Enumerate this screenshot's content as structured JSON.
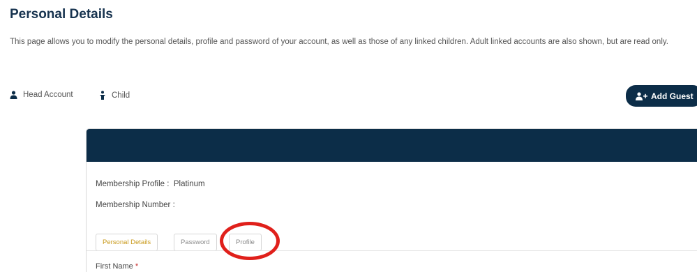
{
  "page": {
    "title": "Personal Details",
    "intro": "This page allows you to modify the personal details, profile and password of your account, as well as those of any linked children. Adult linked accounts are also shown, but are read only."
  },
  "legend": {
    "head_account": {
      "label": "Head Account",
      "icon": "person-icon"
    },
    "child": {
      "label": "Child",
      "icon": "child-icon"
    }
  },
  "actions": {
    "add_guest": {
      "label": "Add Guest",
      "icon": "add-person-icon"
    }
  },
  "card": {
    "membership_profile_label": "Membership Profile :",
    "membership_profile_value": "Platinum",
    "membership_number_label": "Membership Number :",
    "membership_number_value": "",
    "tabs": [
      {
        "label": "Personal Details",
        "active": true
      },
      {
        "label": "Password",
        "active": false
      },
      {
        "label": "Profile",
        "active": false
      }
    ],
    "first_name_label": "First Name",
    "required_marker": "*"
  },
  "colors": {
    "primary": "#0c2d48",
    "title": "#17334f",
    "active_tab": "#c99a1c",
    "highlight": "#e0201b",
    "required": "#c62828"
  }
}
